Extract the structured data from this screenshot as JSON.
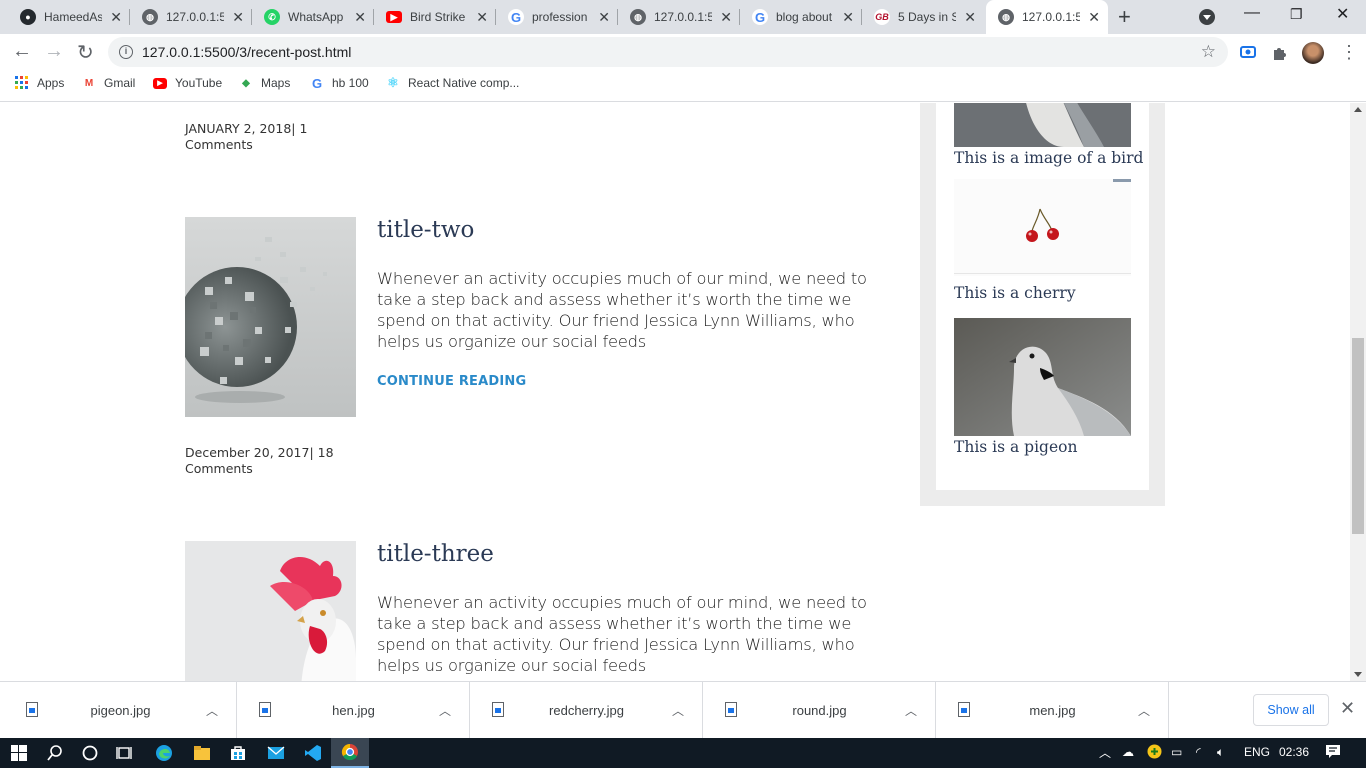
{
  "browser": {
    "tabs": [
      {
        "title": "HameedAs",
        "icon": "github-icon",
        "color": "#24292e"
      },
      {
        "title": "127.0.0.1:5",
        "icon": "globe-icon",
        "color": "#5f6368"
      },
      {
        "title": "WhatsApp",
        "icon": "whatsapp-icon",
        "color": "#25d366"
      },
      {
        "title": "Bird Strike",
        "icon": "youtube-icon",
        "color": "#ff0000"
      },
      {
        "title": "profession",
        "icon": "google-icon",
        "color": "#4285f4"
      },
      {
        "title": "127.0.0.1:5",
        "icon": "globe-icon",
        "color": "#5f6368"
      },
      {
        "title": "blog about",
        "icon": "google-icon",
        "color": "#4285f4"
      },
      {
        "title": "5 Days in S",
        "icon": "blog-icon",
        "color": "#b3122f"
      },
      {
        "title": "127.0.0.1:5",
        "icon": "globe-icon",
        "color": "#5f6368"
      }
    ],
    "url": "127.0.0.1:5500/3/recent-post.html",
    "bookmarks": [
      {
        "label": "Apps",
        "icon": "apps-grid-icon"
      },
      {
        "label": "Gmail",
        "icon": "gmail-icon"
      },
      {
        "label": "YouTube",
        "icon": "youtube-icon"
      },
      {
        "label": "Maps",
        "icon": "maps-icon"
      },
      {
        "label": "hb 100",
        "icon": "google-icon"
      },
      {
        "label": "React Native comp...",
        "icon": "react-icon"
      }
    ]
  },
  "posts": [
    {
      "meta_line1": "JANUARY 2, 2018| 1",
      "meta_line2": "Comments"
    },
    {
      "title": "title-two",
      "text": "Whenever an activity occupies much of our mind, we need to take a step back and assess whether it’s worth the time we spend on that activity. Our friend Jessica Lynn Williams, who helps us organize our social feeds",
      "continue": "CONTINUE READING",
      "meta_line1": "December 20, 2017| 18",
      "meta_line2": "Comments"
    },
    {
      "title": "title-three",
      "text": "Whenever an activity occupies much of our mind, we need to take a step back and assess whether it’s worth the time we spend on that activity. Our friend Jessica Lynn Williams, who helps us organize our social feeds"
    }
  ],
  "sidebar": {
    "items": [
      {
        "caption": "This is a image of a bird"
      },
      {
        "caption": "This is a cherry"
      },
      {
        "caption": "This is a pigeon"
      }
    ]
  },
  "downloads": {
    "files": [
      "pigeon.jpg",
      "hen.jpg",
      "redcherry.jpg",
      "round.jpg",
      "men.jpg"
    ],
    "show_all": "Show all"
  },
  "taskbar": {
    "language": "ENG",
    "time": "02:36"
  }
}
